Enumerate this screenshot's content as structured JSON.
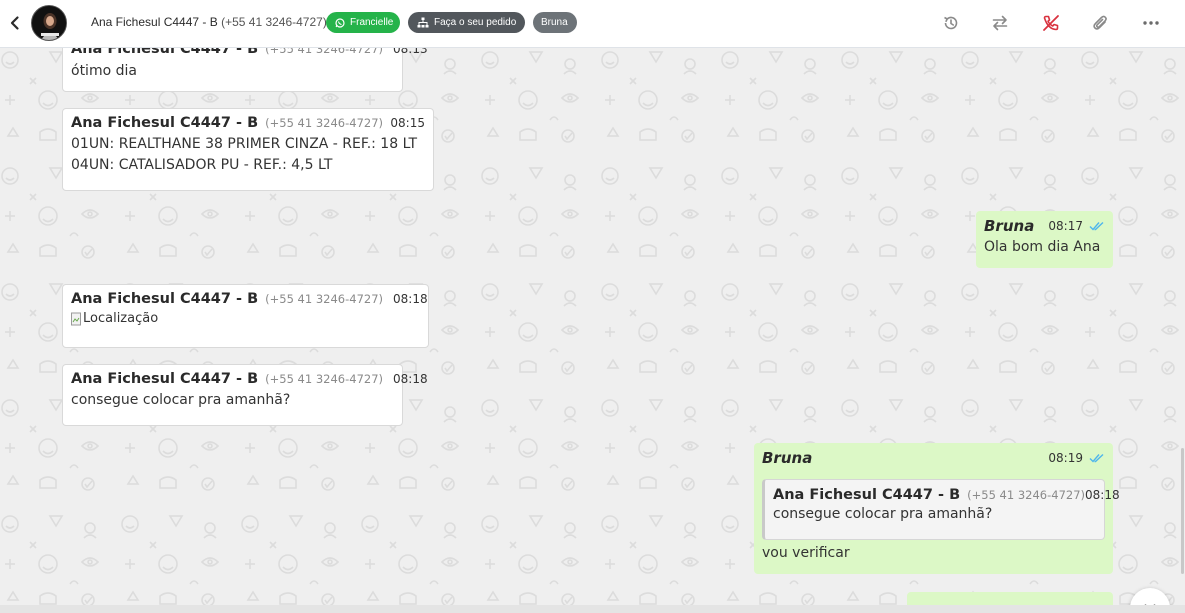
{
  "header": {
    "contact_name": "Ana Fichesul C4447 - B",
    "contact_phone": "(+55 41 3246-4727)",
    "tags": {
      "whatsapp_label": "Francielle",
      "order_label": "Faça o seu pedido",
      "agent_label": "Bruna"
    },
    "icons": [
      "back-icon",
      "avatar",
      "whatsapp-icon",
      "sitemap-icon",
      "history-icon",
      "transfer-icon",
      "end-call-icon",
      "attachment-icon",
      "more-icon"
    ]
  },
  "messages": [
    {
      "direction": "in",
      "sender": "Ana Fichesul C4447 - B",
      "phone": "(+55 41 3246-4727)",
      "time": "08:13",
      "text": "ótimo dia"
    },
    {
      "direction": "in",
      "sender": "Ana Fichesul C4447 - B",
      "phone": "(+55 41 3246-4727)",
      "time": "08:15",
      "lines": [
        "01UN: REALTHANE 38 PRIMER CINZA - REF.: 18 LT",
        "04UN: CATALISADOR PU - REF.: 4,5 LT"
      ]
    },
    {
      "direction": "out",
      "sender": "Bruna",
      "time": "08:17",
      "text": "Ola bom dia Ana",
      "status": "read"
    },
    {
      "direction": "in",
      "sender": "Ana Fichesul C4447 - B",
      "phone": "(+55 41 3246-4727)",
      "time": "08:18",
      "image_alt": "Localização",
      "blocked_icon": "block-icon"
    },
    {
      "direction": "in",
      "sender": "Ana Fichesul C4447 - B",
      "phone": "(+55 41 3246-4727)",
      "time": "08:18",
      "text": "consegue colocar pra amanhã?"
    },
    {
      "direction": "out",
      "sender": "Bruna",
      "time": "08:19",
      "status": "read",
      "quoted": {
        "sender": "Ana Fichesul C4447 - B",
        "phone": "(+55 41 3246-4727)",
        "time": "08:18",
        "text": "consegue colocar pra amanhã?"
      },
      "text": "vou verificar"
    }
  ],
  "colors": {
    "chat_background": "#efefef",
    "outgoing_bubble": "#dcf8c6",
    "incoming_bubble": "#ffffff",
    "whatsapp_tag": "#25b34a",
    "read_ticks": "#4fb6ec"
  }
}
